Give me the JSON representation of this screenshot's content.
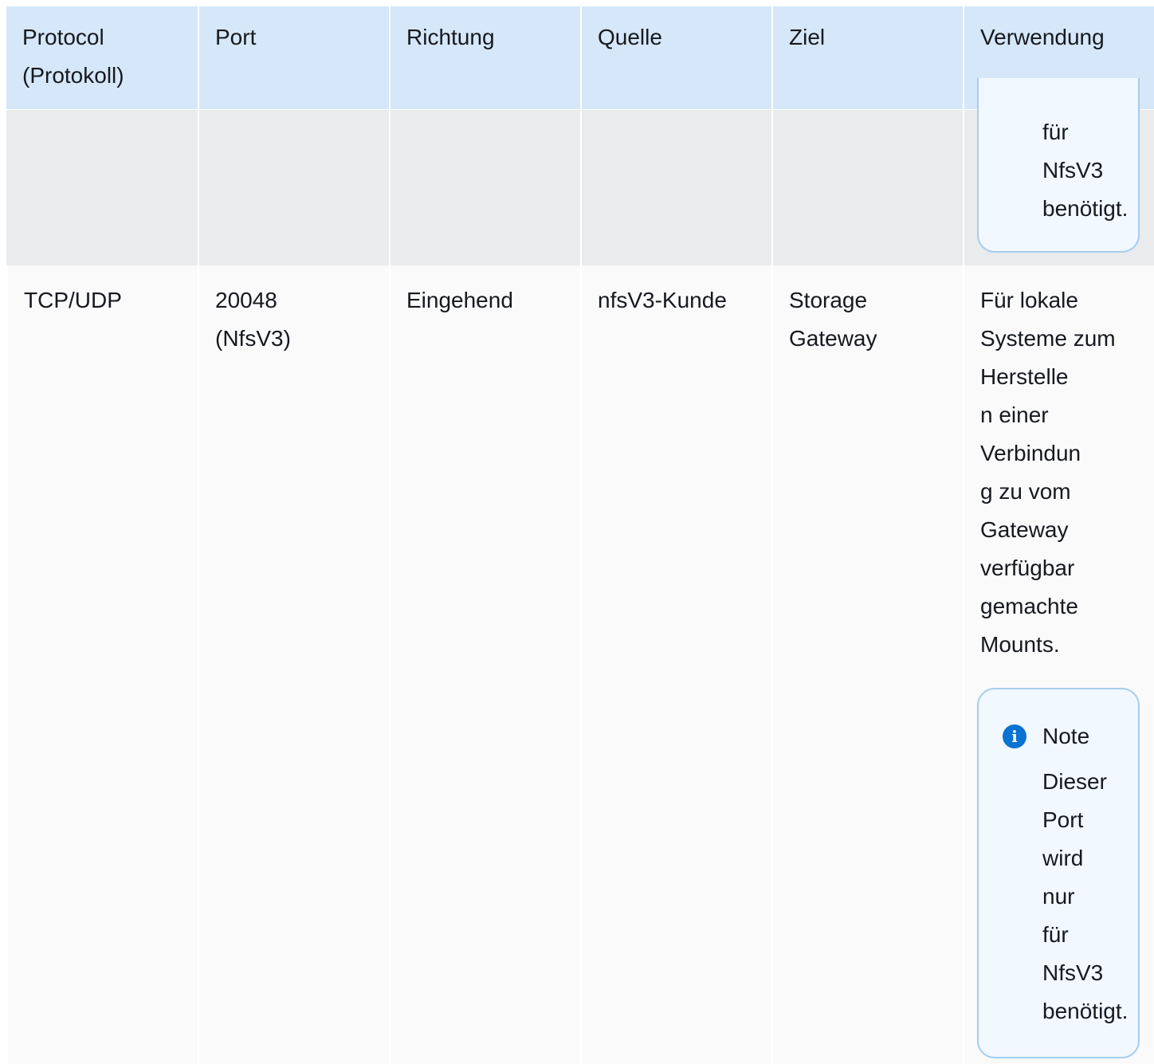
{
  "headers": [
    "Protocol (Protokoll)",
    "Port",
    "Richtung",
    "Quelle",
    "Ziel",
    "Verwendung"
  ],
  "partial_note_lines": [
    "für",
    "NfsV3",
    "benötigt."
  ],
  "row": {
    "protocol": "TCP/UDP",
    "port": "20048 (NfsV3)",
    "direction": "Eingehend",
    "source": "nfsV3-Kunde",
    "target": "Storage Gateway",
    "usage_lines": [
      "Für lokale",
      "Systeme zum",
      "Herstelle",
      "n einer",
      "Verbindun",
      "g zu vom",
      "Gateway",
      "verfügbar",
      "gemachte",
      "Mounts."
    ]
  },
  "note": {
    "title": "Note",
    "lines": [
      "Dieser",
      "Port",
      "wird",
      "nur",
      "für",
      "NfsV3",
      "benötigt."
    ],
    "icon": "info-icon"
  }
}
